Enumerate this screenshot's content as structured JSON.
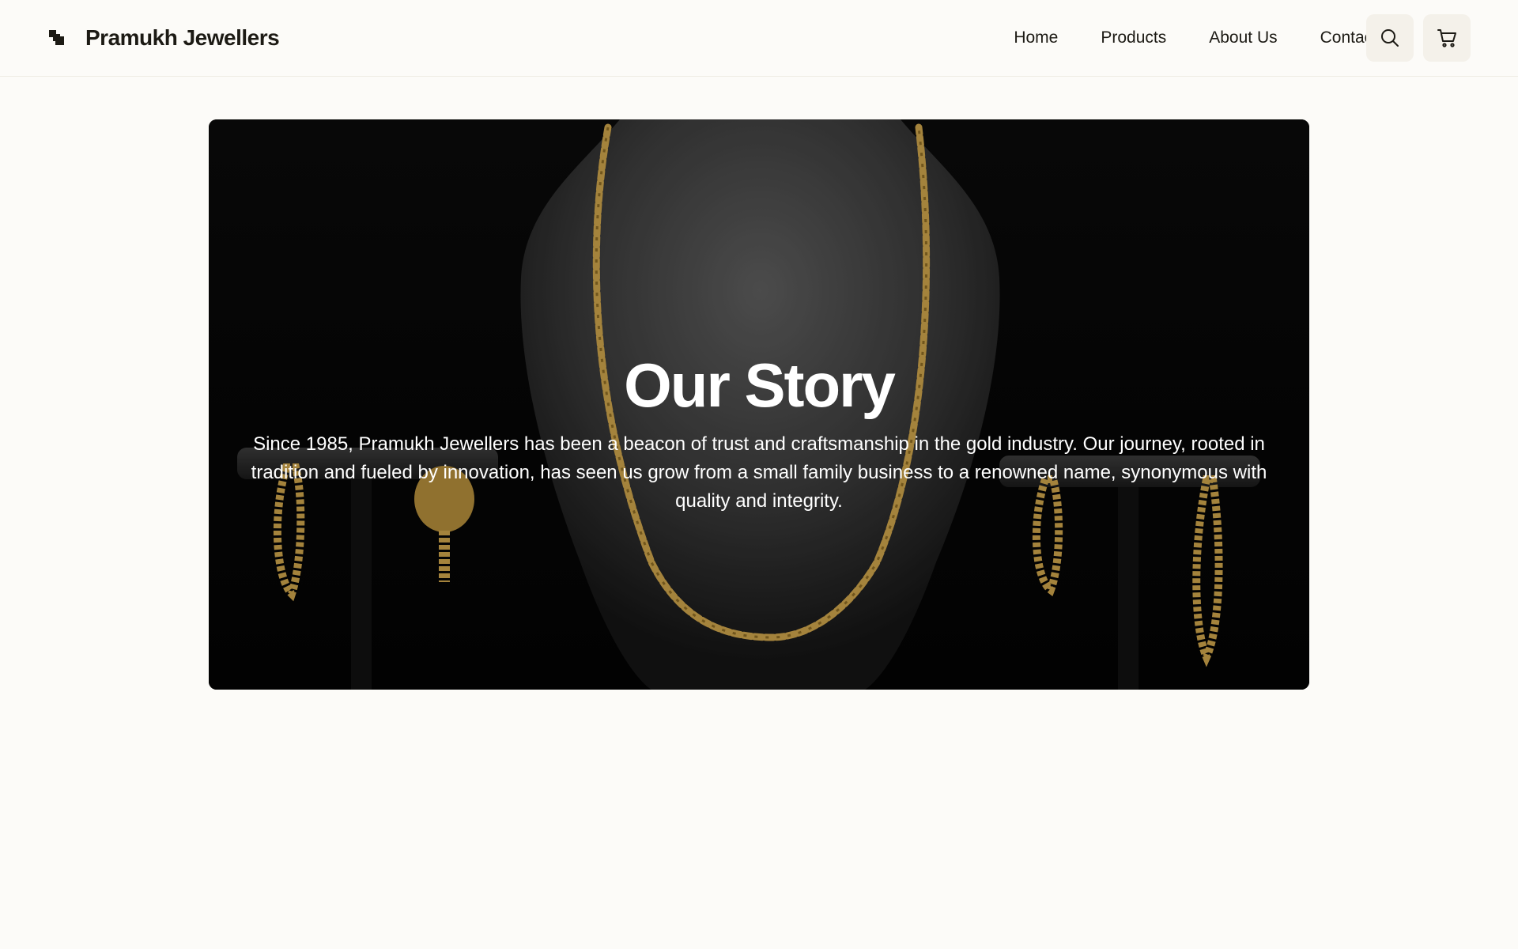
{
  "brand": {
    "name": "Pramukh Jewellers",
    "logo_icon": "brand-mark-icon"
  },
  "nav": {
    "items": [
      {
        "label": "Home"
      },
      {
        "label": "Products"
      },
      {
        "label": "About Us"
      },
      {
        "label": "Contact"
      }
    ]
  },
  "actions": {
    "search_icon": "search-icon",
    "cart_icon": "cart-icon"
  },
  "hero": {
    "title": "Our Story",
    "text": "Since 1985, Pramukh Jewellers has been a beacon of trust and craftsmanship in the gold industry. Our journey, rooted in tradition and fueled by innovation, has seen us grow from a small family business to a renowned name, synonymous with quality and integrity."
  },
  "colors": {
    "background": "#fcfbf8",
    "text": "#1c1a14",
    "icon_button": "#f4f1ea",
    "gold": "#c9a04a"
  }
}
